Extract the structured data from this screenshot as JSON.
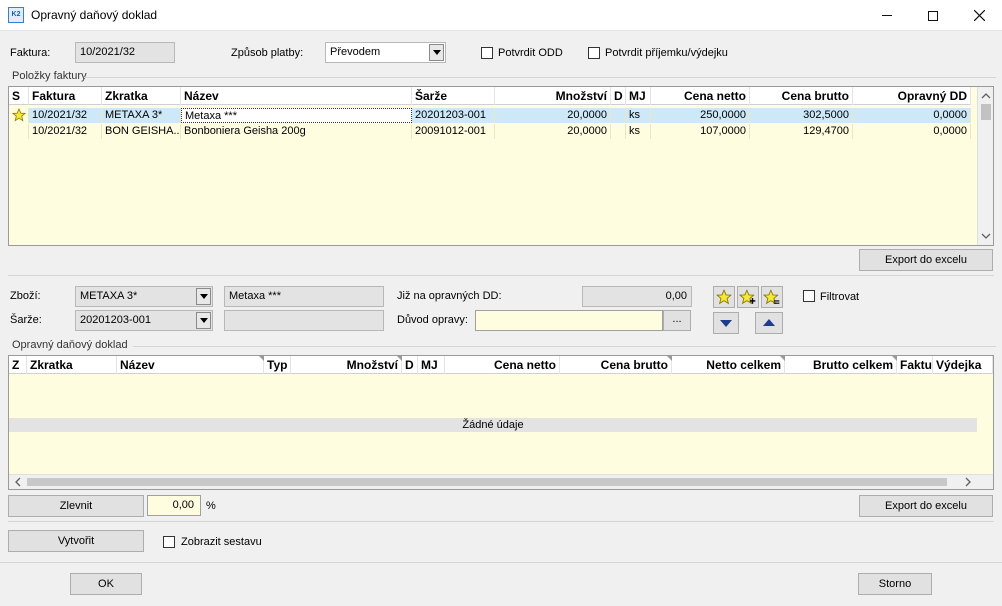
{
  "window": {
    "title": "Opravný daňový doklad",
    "app_icon": "K2"
  },
  "header": {
    "faktura_label": "Faktura:",
    "faktura_value": "10/2021/32",
    "zpusob_label": "Způsob platby:",
    "zpusob_value": "Převodem",
    "potvrdit_odd": "Potvrdit ODD",
    "potvrdit_prijemku": "Potvrdit příjemku/výdejku"
  },
  "polozky": {
    "title": "Položky faktury",
    "columns": [
      "S",
      "Faktura",
      "Zkratka",
      "Název",
      "Šarže",
      "Množství",
      "D",
      "MJ",
      "Cena netto",
      "Cena brutto",
      "Opravný DD"
    ],
    "rows": [
      {
        "faktura": "10/2021/32",
        "zkratka": "METAXA 3*",
        "nazev": "Metaxa ***",
        "sarze": "20201203-001",
        "mnozstvi": "20,0000",
        "d": "",
        "mj": "ks",
        "netto": "250,0000",
        "brutto": "302,5000",
        "opravny": "0,0000"
      },
      {
        "faktura": "10/2021/32",
        "zkratka": "BON GEISHA...",
        "nazev": "Bonboniera Geisha 200g",
        "sarze": "20091012-001",
        "mnozstvi": "20,0000",
        "d": "",
        "mj": "ks",
        "netto": "107,0000",
        "brutto": "129,4700",
        "opravny": "0,0000"
      }
    ],
    "export_label": "Export do excelu"
  },
  "detail": {
    "zbozi_label": "Zboží:",
    "zbozi_value": "METAXA 3*",
    "zbozi_name": "Metaxa ***",
    "sarze_label": "Šarže:",
    "sarze_value": "20201203-001",
    "jiz_label": "Již na opravných DD:",
    "jiz_value": "0,00",
    "duvod_label": "Důvod opravy:",
    "duvod_value": "",
    "ellipsis": "...",
    "filtrovat": "Filtrovat"
  },
  "opravny": {
    "title": "Opravný daňový doklad",
    "columns": [
      "Z",
      "Zkratka",
      "Název",
      "Typ",
      "Množství",
      "D",
      "MJ",
      "Cena netto",
      "Cena brutto",
      "Netto celkem",
      "Brutto celkem",
      "Faktura",
      "Výdejka"
    ],
    "empty_text": "Žádné údaje",
    "export_label": "Export do excelu"
  },
  "footer": {
    "zlevnit_label": "Zlevnit",
    "zlevnit_value": "0,00",
    "percent": "%",
    "vytvorit_label": "Vytvořit",
    "zobrazit_label": "Zobrazit sestavu",
    "ok_label": "OK",
    "storno_label": "Storno"
  },
  "colors": {
    "grid_bg": "#fffde0",
    "selected_row": "#cde8f6",
    "star": "#f5e83b"
  }
}
